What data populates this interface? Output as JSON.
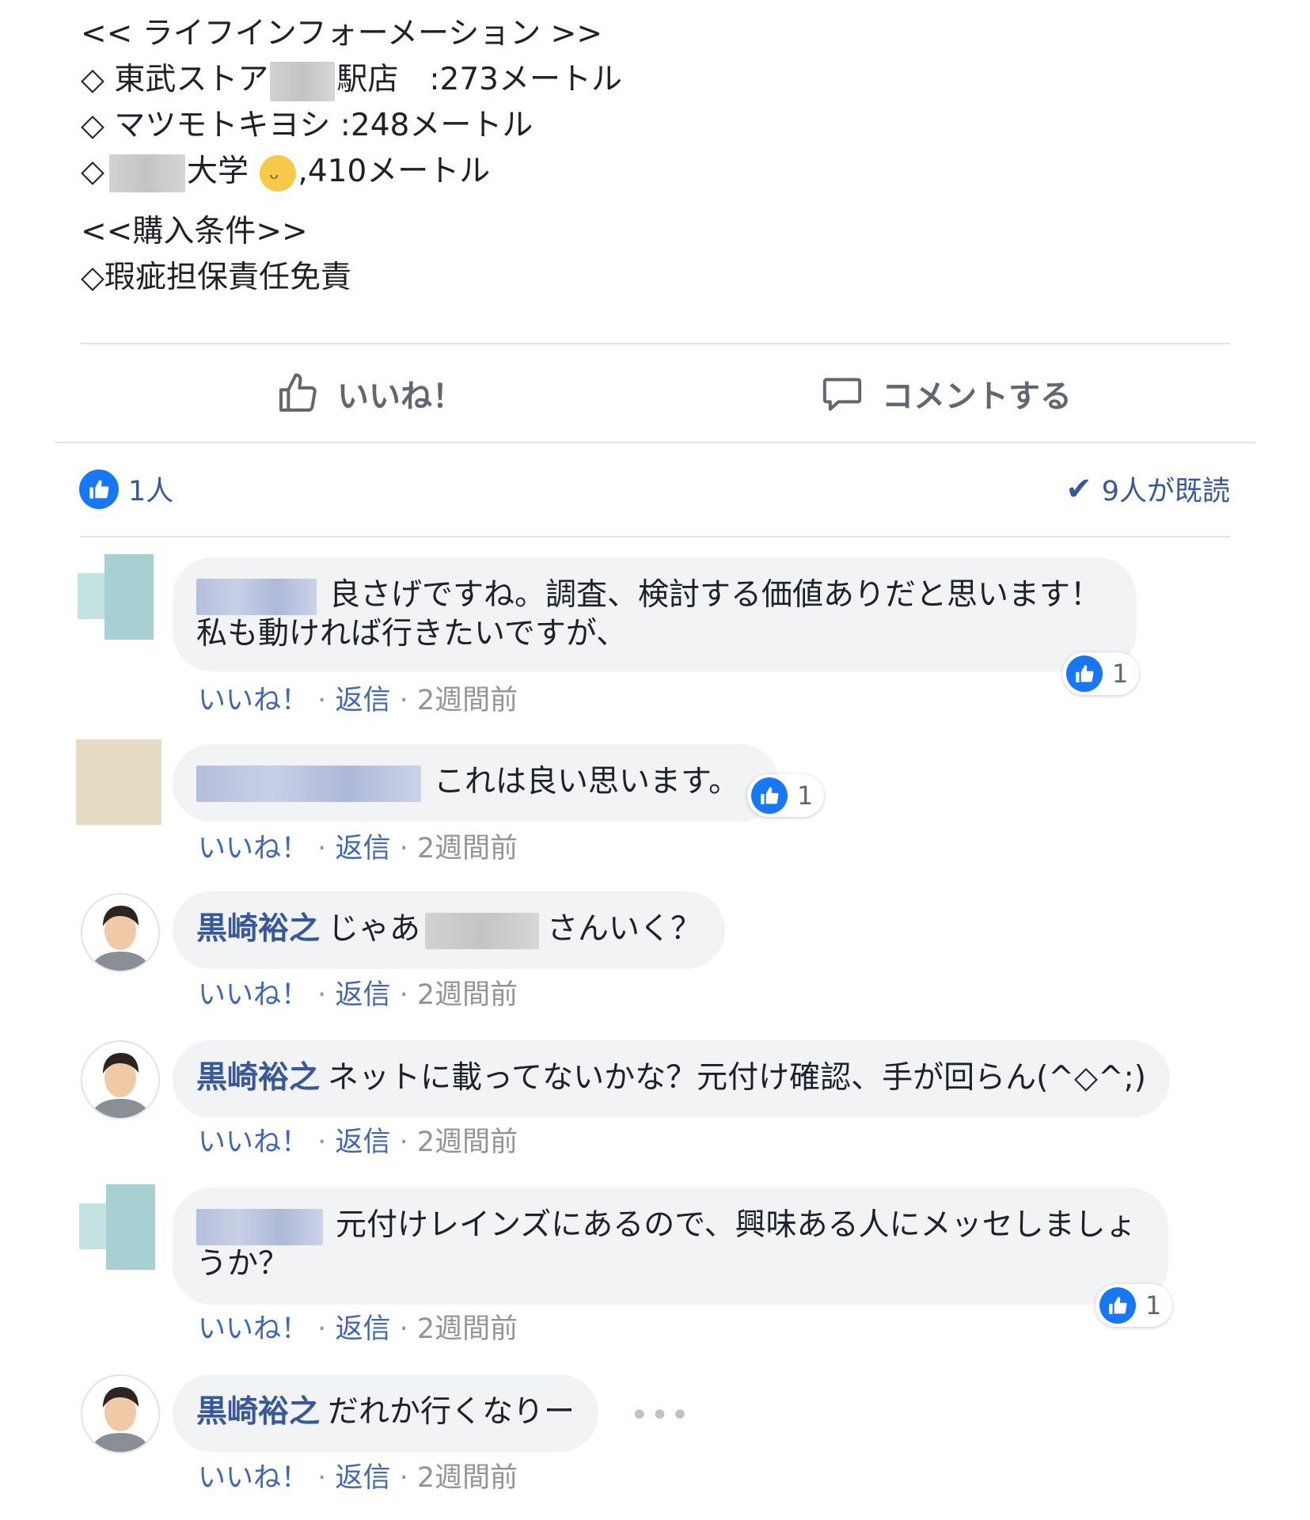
{
  "post": {
    "lines": [
      "<< ライフインフォーメーション >>",
      "◇ 東武ストア",
      "駅店　:273メートル",
      "◇ マツモトキヨシ :248メートル",
      "◇",
      "大学",
      ",410メートル",
      "<<購入条件>>",
      "◇瑕疵担保責任免責"
    ]
  },
  "actions": {
    "like_label": "いいね！",
    "comment_label": "コメントする"
  },
  "summary": {
    "likes": "1人",
    "seen": "9人が既読"
  },
  "comments": [
    {
      "name": "",
      "text": "良さげですね。調査、検討する価値ありだと思います！私も動ければ行きたいですが、",
      "reactions": "1",
      "like": "いいね！",
      "reply": "返信",
      "time": "· 2週間前"
    },
    {
      "name": "",
      "text": "これは良い思います。",
      "reactions": "1",
      "like": "いいね！",
      "reply": "返信",
      "time": "· 2週間前"
    },
    {
      "name": "黒崎裕之",
      "text_a": "じゃあ",
      "text_b": "さんいく？",
      "like": "いいね！",
      "reply": "返信",
      "time": "· 2週間前"
    },
    {
      "name": "黒崎裕之",
      "text": "ネットに載ってないかな？元付け確認、手が回らん(^◇^;)",
      "like": "いいね！",
      "reply": "返信",
      "time": "· 2週間前"
    },
    {
      "name": "",
      "text": "元付けレインズにあるので、興味ある人にメッセしましょうか？",
      "reactions": "1",
      "like": "いいね！",
      "reply": "返信",
      "time": "· 2週間前"
    },
    {
      "name": "黒崎裕之",
      "text": "だれか行くなりー",
      "like": "いいね！",
      "reply": "返信",
      "time": "· 2週間前"
    }
  ],
  "meta_separator": "·",
  "more_dots": "•••",
  "colors": {
    "link": "#385898",
    "bubble": "#f2f3f5",
    "like_blue": "#1877f2",
    "meta_gray": "#90949c"
  },
  "icons": [
    "thumbs-up-icon",
    "comment-bubble-icon",
    "like-badge-icon",
    "check-icon",
    "more-icon"
  ]
}
